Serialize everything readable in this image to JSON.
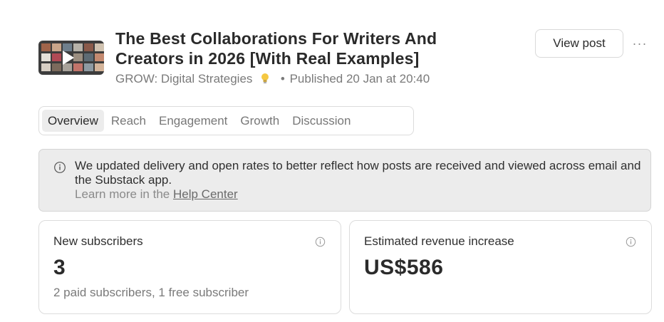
{
  "post": {
    "title": "The Best Collaborations For Writers And Creators in 2026 [With Real Examples]",
    "publication": "GROW: Digital Strategies",
    "published": "Published 20 Jan at 20:40"
  },
  "actions": {
    "view_post": "View post",
    "more": "···"
  },
  "tabs": [
    {
      "label": "Overview",
      "active": true
    },
    {
      "label": "Reach"
    },
    {
      "label": "Engagement"
    },
    {
      "label": "Growth"
    },
    {
      "label": "Discussion"
    }
  ],
  "notice": {
    "text": "We updated delivery and open rates to better reflect how posts are received and viewed across email and the Substack app.",
    "learn_prefix": "Learn more in the",
    "learn_link": "Help Center"
  },
  "cards": [
    {
      "label": "New subscribers",
      "value": "3",
      "sub": "2 paid subscribers, 1 free subscriber"
    },
    {
      "label": "Estimated revenue increase",
      "value": "US$586",
      "sub": ""
    }
  ],
  "icons": {
    "info": "info-circle-icon",
    "bulb": "lightbulb-icon",
    "play": "play-icon"
  },
  "colors": {
    "active_tab_bg": "#ececec",
    "notice_bg": "#ececec",
    "text": "#2b2b2b",
    "muted": "#7a7a7a"
  }
}
